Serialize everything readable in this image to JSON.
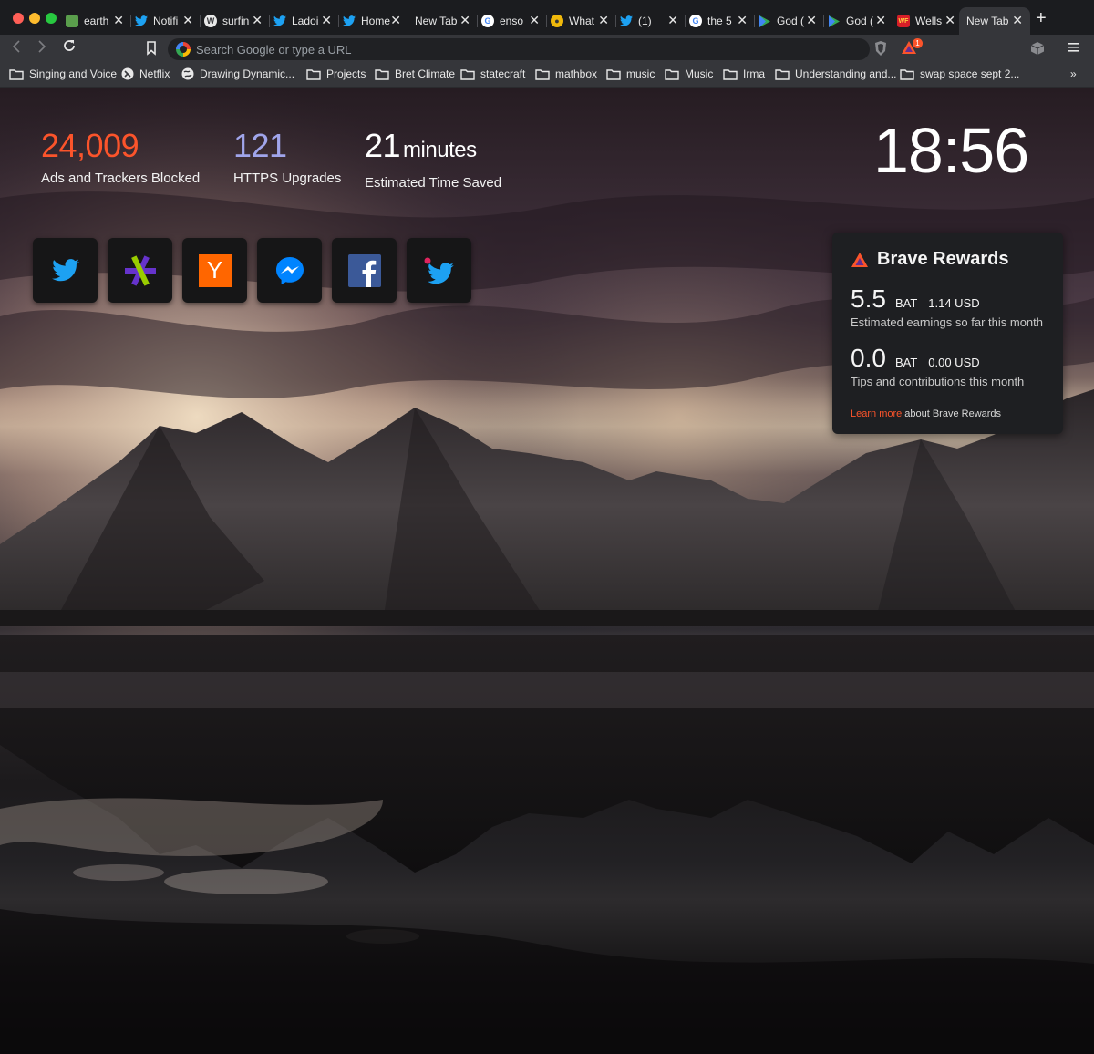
{
  "tabs": [
    {
      "label": "earth",
      "icon": "earth-favicon-icon",
      "color": "#4caf50"
    },
    {
      "label": "Notifi",
      "icon": "twitter-favicon-icon",
      "color": "#1da1f2"
    },
    {
      "label": "surfin",
      "icon": "wordpress-favicon-icon",
      "color": "#5a90c0"
    },
    {
      "label": "Ladoi",
      "icon": "twitter-favicon-icon",
      "color": "#1da1f2"
    },
    {
      "label": "Home",
      "icon": "twitter-favicon-icon",
      "color": "#1da1f2"
    },
    {
      "label": "New Tab",
      "icon": "",
      "color": ""
    },
    {
      "label": "enso",
      "icon": "google-favicon-icon",
      "color": "#4285f4"
    },
    {
      "label": "What",
      "icon": "coin-favicon-icon",
      "color": "#f0b90b"
    },
    {
      "label": "(1)",
      "icon": "twitter-favicon-icon",
      "color": "#1da1f2"
    },
    {
      "label": "the 5",
      "icon": "google-favicon-icon",
      "color": "#4285f4"
    },
    {
      "label": "God (",
      "icon": "play-favicon-icon",
      "color": "#34a853"
    },
    {
      "label": "God (",
      "icon": "play-favicon-icon",
      "color": "#34a853"
    },
    {
      "label": "Wells",
      "icon": "wells-favicon-icon",
      "color": "#d71e28"
    },
    {
      "label": "New Tab",
      "icon": "",
      "color": "",
      "active": true
    }
  ],
  "toolbar": {
    "omnibox_placeholder": "Search Google or type a URL",
    "rewards_badge": "1"
  },
  "bookmarks": [
    {
      "label": "Singing and Voice",
      "icon": "folder-icon"
    },
    {
      "label": "Netflix",
      "icon": "netflix-favicon-icon"
    },
    {
      "label": "Drawing Dynamic...",
      "icon": "globe-favicon-icon"
    },
    {
      "label": "Projects",
      "icon": "folder-icon"
    },
    {
      "label": "Bret Climate",
      "icon": "folder-icon"
    },
    {
      "label": "statecraft",
      "icon": "folder-icon"
    },
    {
      "label": "mathbox",
      "icon": "folder-icon"
    },
    {
      "label": "music",
      "icon": "folder-icon"
    },
    {
      "label": "Music",
      "icon": "folder-icon"
    },
    {
      "label": "Irma",
      "icon": "folder-icon"
    },
    {
      "label": "Understanding and...",
      "icon": "folder-icon"
    },
    {
      "label": "swap space sept 2...",
      "icon": "folder-icon"
    }
  ],
  "stats": [
    {
      "value": "24,009",
      "unit": "",
      "label": "Ads and Trackers Blocked",
      "color": "#fb542b"
    },
    {
      "value": "121",
      "unit": "",
      "label": "HTTPS Upgrades",
      "color": "#a0a5eb"
    },
    {
      "value": "21",
      "unit": "minutes",
      "label": "Estimated Time Saved",
      "color": "#ffffff"
    }
  ],
  "clock": "18:56",
  "top_sites": [
    {
      "icon": "twitter-icon"
    },
    {
      "icon": "etrade-icon"
    },
    {
      "icon": "hacker-news-icon",
      "glyph": "Y"
    },
    {
      "icon": "messenger-icon"
    },
    {
      "icon": "facebook-icon"
    },
    {
      "icon": "twitter-notification-icon"
    }
  ],
  "rewards": {
    "title": "Brave Rewards",
    "earnings_amount": "5.5",
    "earnings_currency": "BAT",
    "earnings_usd": "1.14 USD",
    "earnings_label": "Estimated earnings so far this month",
    "tips_amount": "0.0",
    "tips_currency": "BAT",
    "tips_usd": "0.00 USD",
    "tips_label": "Tips and contributions this month",
    "learn_link": "Learn more",
    "learn_text": "about Brave Rewards",
    "accent": "#fb542b"
  }
}
